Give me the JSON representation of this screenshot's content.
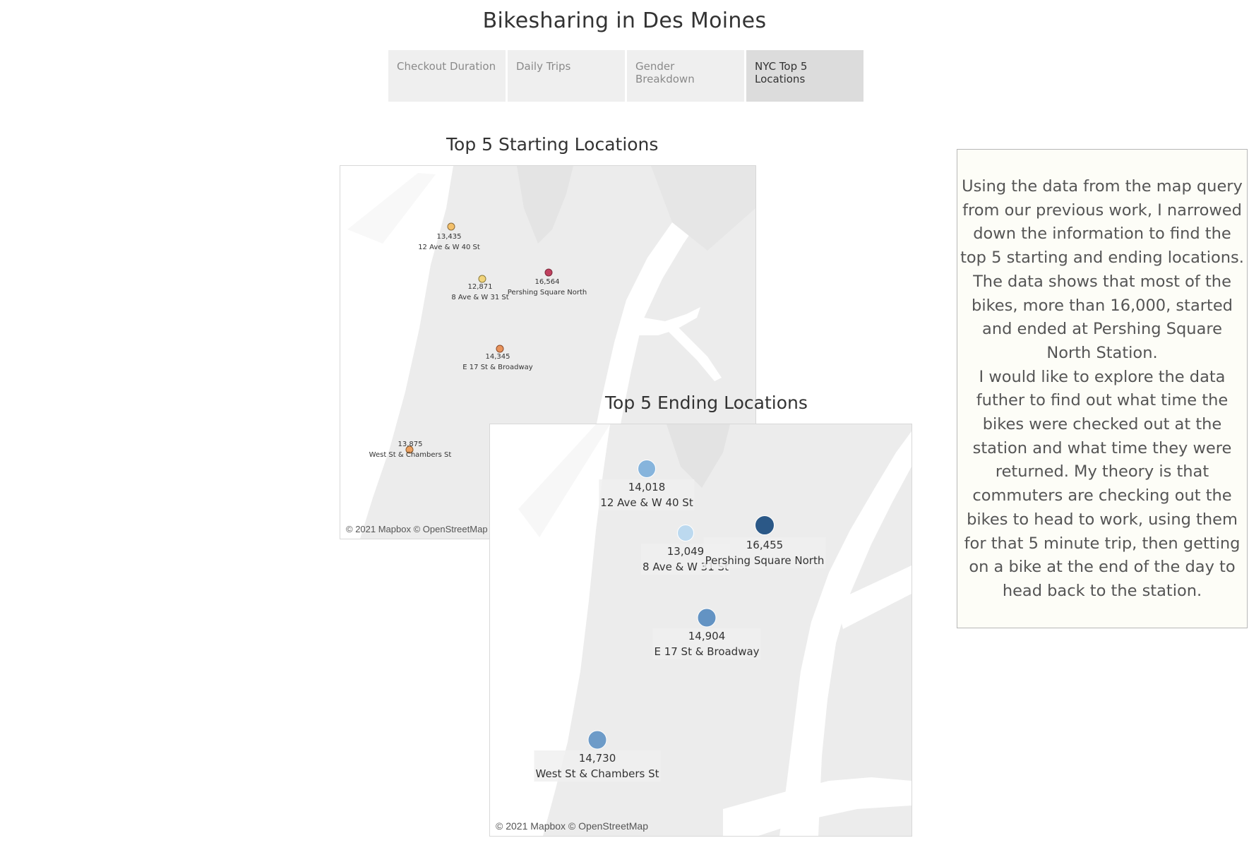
{
  "title": "Bikesharing in Des Moines",
  "tabs": [
    {
      "label": "Checkout Duration",
      "active": false
    },
    {
      "label": "Daily Trips",
      "active": false
    },
    {
      "label": "Gender Breakdown",
      "active": false
    },
    {
      "label": "NYC Top 5 Locations",
      "active": true
    }
  ],
  "start_map": {
    "title": "Top 5 Starting Locations",
    "credit": "© 2021 Mapbox © OpenStreetMap",
    "color_scale": "yellow-orange-red (low to high trips)",
    "points": [
      {
        "value": "13,435",
        "trips": 13435,
        "station": "12 Ave & W 40 St",
        "color": "#f3c06a"
      },
      {
        "value": "12,871",
        "trips": 12871,
        "station": "8 Ave & W 31 St",
        "color": "#f1d37a"
      },
      {
        "value": "16,564",
        "trips": 16564,
        "station": "Pershing Square North",
        "color": "#c0405e"
      },
      {
        "value": "14,345",
        "trips": 14345,
        "station": "E 17 St & Broadway",
        "color": "#e8925a"
      },
      {
        "value": "13,875",
        "trips": 13875,
        "station": "West St & Chambers St",
        "color": "#eda160"
      }
    ]
  },
  "end_map": {
    "title": "Top 5 Ending Locations",
    "credit": "© 2021 Mapbox © OpenStreetMap",
    "color_scale": "blue (low to high trips)",
    "points": [
      {
        "value": "14,018",
        "trips": 14018,
        "station": "12 Ave & W 40 St",
        "color": "#86b4dc"
      },
      {
        "value": "13,049",
        "trips": 13049,
        "station": "8 Ave & W 31 St",
        "color": "#bcd9ef"
      },
      {
        "value": "16,455",
        "trips": 16455,
        "station": "Pershing Square North",
        "color": "#2b5887"
      },
      {
        "value": "14,904",
        "trips": 14904,
        "station": "E 17 St & Broadway",
        "color": "#6393c3"
      },
      {
        "value": "14,730",
        "trips": 14730,
        "station": "West St & Chambers St",
        "color": "#6d9bc8"
      }
    ]
  },
  "note": {
    "text": "Using the data from the map query from our previous work, I narrowed down the information to find the top 5 starting and ending locations. The data shows that most of the bikes, more than 16,000, started and ended at Pershing Square North Station.\nI would like to explore the data futher to find out what time the bikes were checked out at the station and what time they were returned. My theory is that commuters are checking out the bikes to head to work, using them for that 5 minute trip, then getting on a bike at the end of the day to head back to the station."
  }
}
